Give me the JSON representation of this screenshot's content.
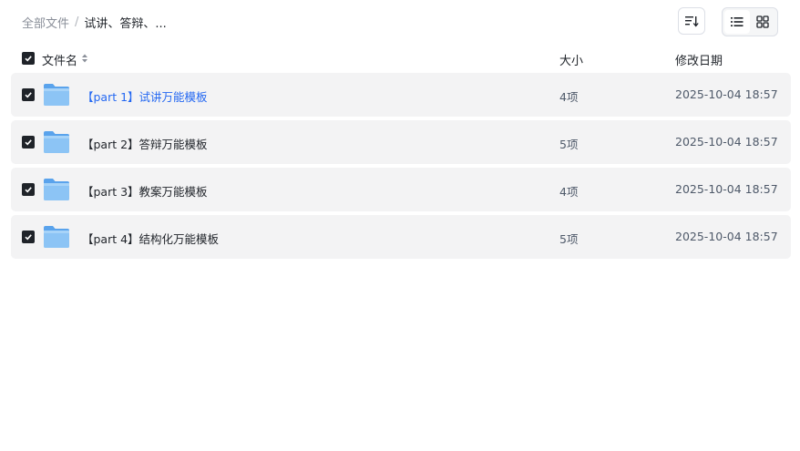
{
  "breadcrumb": {
    "root": "全部文件",
    "separator": "/",
    "current": "试讲、答辩、..."
  },
  "toolbar": {
    "sort_icon": "sort-lines-icon",
    "views": [
      "list-view-icon",
      "grid-view-icon"
    ],
    "active_view": "list"
  },
  "table": {
    "headers": {
      "name": "文件名",
      "size": "大小",
      "date": "修改日期"
    },
    "rows": [
      {
        "name": "【part 1】试讲万能模板",
        "size": "4项",
        "date": "2025-10-04 18:57",
        "highlighted": true
      },
      {
        "name": "【part 2】答辩万能模板",
        "size": "5项",
        "date": "2025-10-04 18:57",
        "highlighted": false
      },
      {
        "name": "【part 3】教案万能模板",
        "size": "4项",
        "date": "2025-10-04 18:57",
        "highlighted": false
      },
      {
        "name": "【part 4】结构化万能模板",
        "size": "5项",
        "date": "2025-10-04 18:57",
        "highlighted": false
      }
    ]
  },
  "colors": {
    "accent": "#2468f2",
    "row_bg": "#f3f3f4",
    "folder": "#7db8f2"
  }
}
